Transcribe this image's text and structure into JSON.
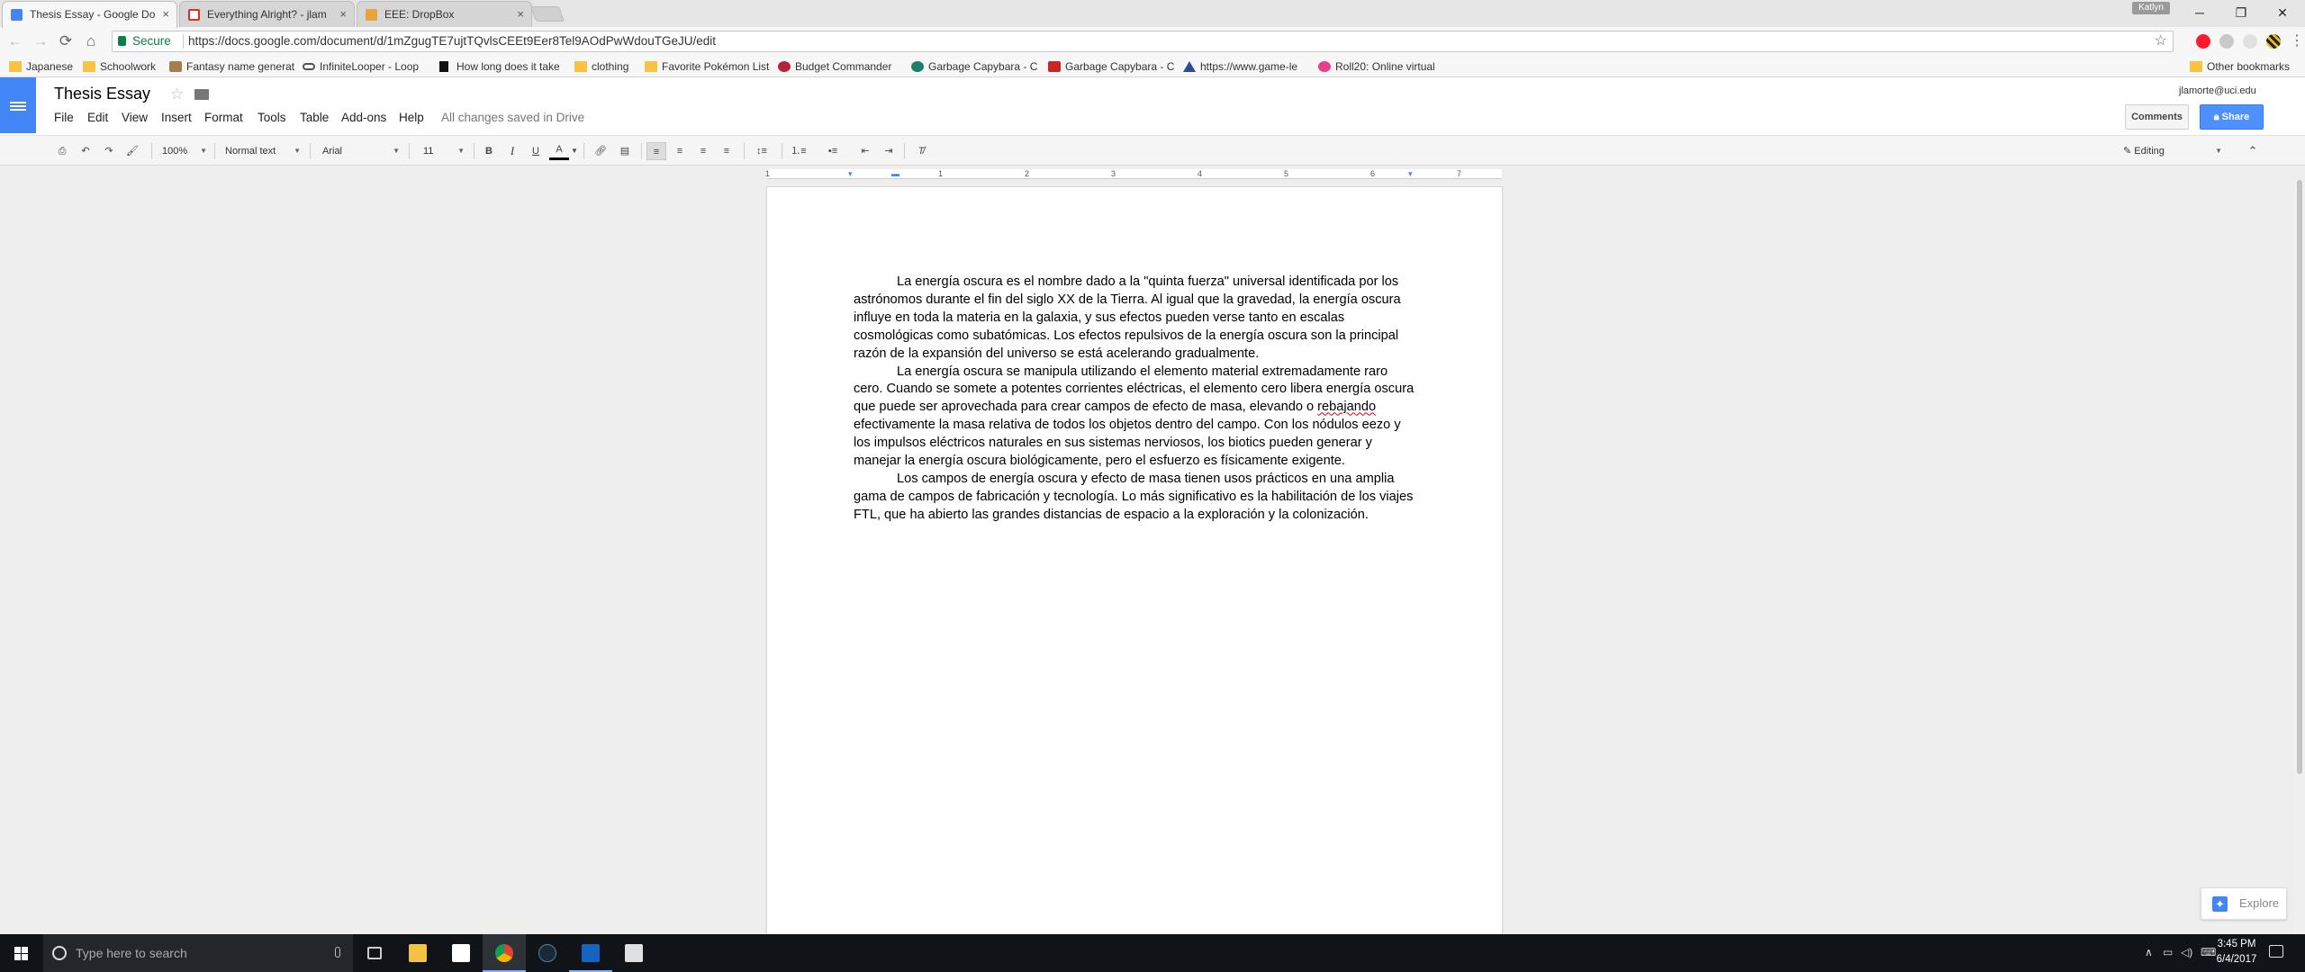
{
  "browser": {
    "tabs": [
      {
        "title": "Thesis Essay - Google Do",
        "close": "×",
        "color": "#4285f4"
      },
      {
        "title": "Everything Alright? - jlam",
        "close": "×",
        "color": "#d93025"
      },
      {
        "title": "EEE: DropBox",
        "close": "×",
        "color": "#e8a33d"
      }
    ],
    "profile": "Katlyn",
    "window_buttons": {
      "minimize": "─",
      "restore": "❐",
      "close": "✕"
    },
    "nav": {
      "back": "←",
      "forward": "→",
      "reload": "⟳",
      "home": "⌂"
    },
    "omnibox": {
      "secure_label": "Secure",
      "url": "https://docs.google.com/document/d/1mZgugTE7ujtTQvlsCEEt9Eer8Tel9AOdPwWdouTGeJU/edit",
      "star": "☆"
    }
  },
  "bookmarks": {
    "items": [
      {
        "label": "Japanese",
        "icon": "folder-icon"
      },
      {
        "label": "Schoolwork",
        "icon": "folder-icon"
      },
      {
        "label": "Fantasy name generat",
        "icon": "quill-icon"
      },
      {
        "label": "InfiniteLooper - Loop",
        "icon": "loop-icon"
      },
      {
        "label": "How long does it take",
        "icon": "hltb-icon"
      },
      {
        "label": "clothing",
        "icon": "folder-icon"
      },
      {
        "label": "Favorite Pokémon List",
        "icon": "folder-icon"
      },
      {
        "label": "Budget Commander",
        "icon": "budget-icon"
      },
      {
        "label": "Garbage Capybara - C",
        "icon": "capybara-icon"
      },
      {
        "label": "Garbage Capybara - C",
        "icon": "capybara-d-icon"
      },
      {
        "label": "https://www.game-le",
        "icon": "game-icon"
      },
      {
        "label": "Roll20: Online virtual",
        "icon": "roll20-icon"
      }
    ],
    "other": "Other bookmarks"
  },
  "docs": {
    "title": "Thesis Essay",
    "menus": [
      "File",
      "Edit",
      "View",
      "Insert",
      "Format",
      "Tools",
      "Table",
      "Add-ons",
      "Help"
    ],
    "save_status": "All changes saved in Drive",
    "user_email": "jlamorte@uci.edu",
    "comments_label": "Comments",
    "share_label": "Share",
    "toolbar": {
      "zoom": "100%",
      "style": "Normal text",
      "font": "Arial",
      "size": "11",
      "bold": "B",
      "italic": "I",
      "underline": "U",
      "text_color": "A",
      "mode": "Editing"
    },
    "ruler_numbers": [
      "1",
      "1",
      "2",
      "3",
      "4",
      "5",
      "6",
      "7"
    ],
    "paragraphs": [
      {
        "text": "La energía oscura es el nombre dado a la \"quinta fuerza\" universal identificada por los astrónomos durante el fin del siglo XX de la Tierra. Al igual que la gravedad, la energía oscura influye en toda la materia en la galaxia, y sus efectos pueden verse tanto en escalas cosmológicas como subatómicas. Los efectos repulsivos de la energía oscura son la principal razón de la expansión del universo se está acelerando gradualmente."
      },
      {
        "before": "La energía oscura se manipula utilizando el elemento material extremadamente raro cero. Cuando se somete a potentes corrientes eléctricas, el elemento cero libera energía oscura que puede ser aprovechada para crear campos de efecto de masa, elevando o ",
        "misspelled": "rebajando",
        "after": " efectivamente la masa relativa de todos los objetos dentro del campo. Con los nódulos eezo y los impulsos eléctricos naturales en sus sistemas nerviosos, los biotics pueden generar y manejar la energía oscura biológicamente, pero el esfuerzo es físicamente exigente."
      },
      {
        "text": "Los campos de energía oscura y efecto de masa tienen usos prácticos en una amplia gama de campos de fabricación y tecnología. Lo más significativo es la habilitación de los viajes FTL, que ha abierto las grandes distancias de espacio a la exploración y la colonización."
      }
    ],
    "explore_label": "Explore"
  },
  "taskbar": {
    "search_placeholder": "Type here to search",
    "time": "3:45 PM",
    "date": "6/4/2017",
    "tray_caret": "∧"
  },
  "colors": {
    "docs_blue": "#4285f4",
    "share_blue": "#4d90fe",
    "secure_green": "#0b8043",
    "spell_red": "#d50000"
  }
}
